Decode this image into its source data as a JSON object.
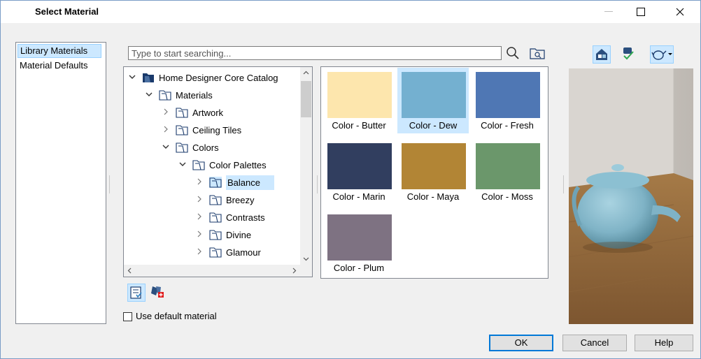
{
  "window": {
    "title": "Select Material"
  },
  "sidebar": {
    "items": [
      {
        "label": "Library Materials",
        "selected": true
      },
      {
        "label": "Material Defaults",
        "selected": false
      }
    ]
  },
  "search": {
    "placeholder": "Type to start searching..."
  },
  "tree": {
    "rows": [
      {
        "label": "Home Designer Core Catalog",
        "expanded": true,
        "level": 0,
        "selected": false
      },
      {
        "label": "Materials",
        "expanded": true,
        "level": 1,
        "selected": false
      },
      {
        "label": "Artwork",
        "expanded": false,
        "level": 2,
        "selected": false
      },
      {
        "label": "Ceiling Tiles",
        "expanded": false,
        "level": 2,
        "selected": false
      },
      {
        "label": "Colors",
        "expanded": true,
        "level": 2,
        "selected": false
      },
      {
        "label": "Color Palettes",
        "expanded": true,
        "level": 3,
        "selected": false
      },
      {
        "label": "Balance",
        "expanded": false,
        "level": 4,
        "selected": true
      },
      {
        "label": "Breezy",
        "expanded": false,
        "level": 4,
        "selected": false
      },
      {
        "label": "Contrasts",
        "expanded": false,
        "level": 4,
        "selected": false
      },
      {
        "label": "Divine",
        "expanded": false,
        "level": 4,
        "selected": false
      },
      {
        "label": "Glamour",
        "expanded": false,
        "level": 4,
        "selected": false
      }
    ]
  },
  "materials": [
    {
      "label": "Color - Butter",
      "color": "#fde6ad",
      "selected": false
    },
    {
      "label": "Color - Dew",
      "color": "#74b0d0",
      "selected": true
    },
    {
      "label": "Color - Fresh",
      "color": "#4f77b4",
      "selected": false
    },
    {
      "label": "Color - Marin",
      "color": "#313e5f",
      "selected": false
    },
    {
      "label": "Color - Maya",
      "color": "#b28535",
      "selected": false
    },
    {
      "label": "Color - Moss",
      "color": "#6b976b",
      "selected": false
    },
    {
      "label": "Color - Plum",
      "color": "#7e7282",
      "selected": false
    }
  ],
  "options": {
    "use_default_label": "Use default material",
    "use_default_checked": false
  },
  "buttons": {
    "ok": "OK",
    "cancel": "Cancel",
    "help": "Help"
  },
  "colors": {
    "selection": "#cce8ff",
    "accent": "#0078d7",
    "preview_object": "#7fb3c6"
  }
}
